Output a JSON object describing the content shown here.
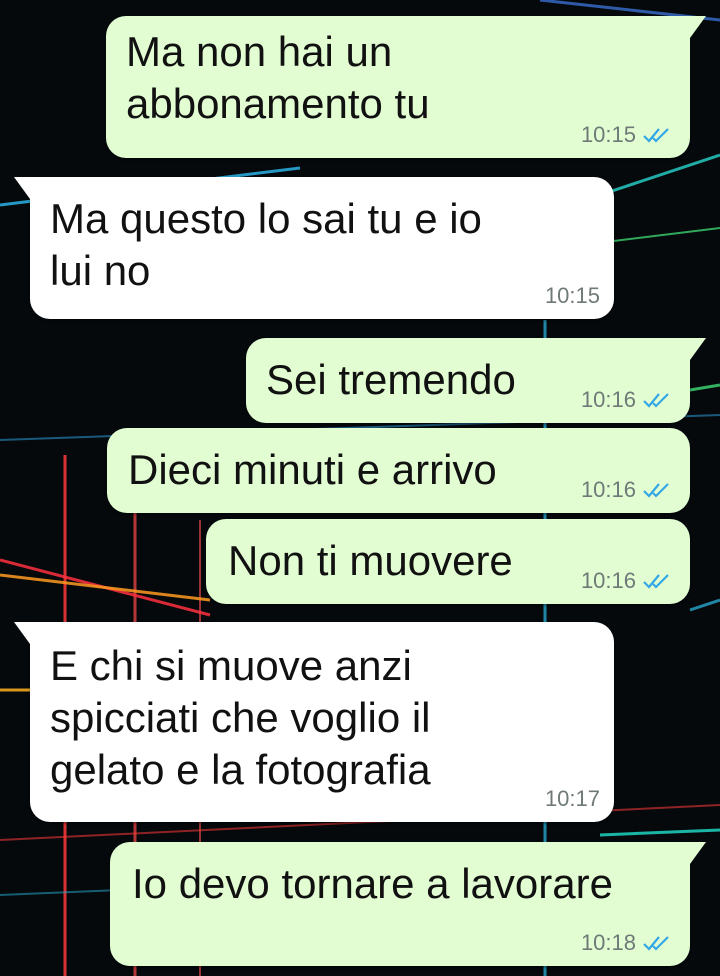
{
  "colors": {
    "outgoing_bubble": "#e2fdd2",
    "incoming_bubble": "#ffffff",
    "read_ticks": "#34a8e6",
    "time_text": "#6f7a78",
    "background": "#05090c"
  },
  "messages": [
    {
      "direction": "outgoing",
      "text": "Ma non hai un\nabbonamento tu",
      "time": "10:15",
      "status_icon": "read-double-check-icon"
    },
    {
      "direction": "incoming",
      "text": "Ma questo lo sai tu e io\nlui no",
      "time": "10:15"
    },
    {
      "direction": "outgoing",
      "text": "Sei tremendo",
      "time": "10:16",
      "status_icon": "read-double-check-icon"
    },
    {
      "direction": "outgoing",
      "text": "Dieci minuti e arrivo",
      "time": "10:16",
      "status_icon": "read-double-check-icon"
    },
    {
      "direction": "outgoing",
      "text": "Non ti muovere",
      "time": "10:16",
      "status_icon": "read-double-check-icon"
    },
    {
      "direction": "incoming",
      "text": "E chi si muove anzi\nspicciati che voglio il\ngelato e la fotografia",
      "time": "10:17"
    },
    {
      "direction": "outgoing",
      "text": "Io devo tornare a lavorare",
      "time": "10:18",
      "status_icon": "read-double-check-icon"
    }
  ]
}
